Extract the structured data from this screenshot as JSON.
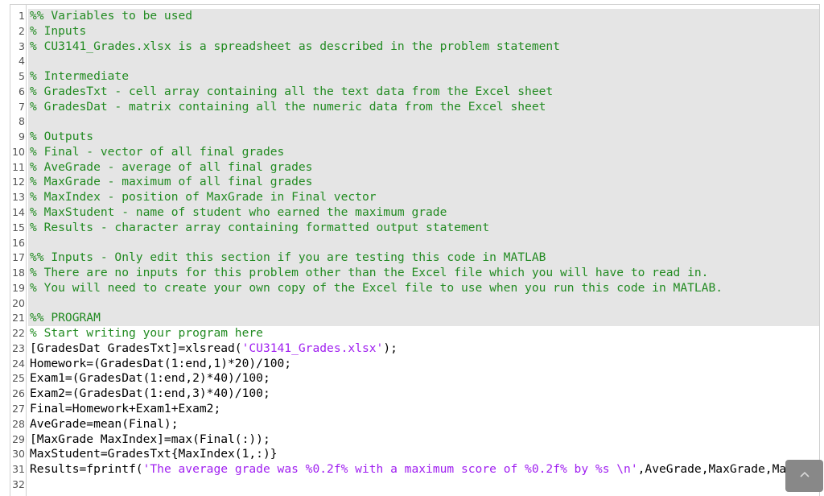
{
  "editor": {
    "colors": {
      "comment": "#228b22",
      "string": "#a020f0",
      "code": "#000000",
      "shaded_section": "#e5e5e5"
    },
    "shaded_lines_through": 21,
    "lines": [
      {
        "n": "1",
        "segs": [
          {
            "type": "comment",
            "text": "%% Variables to be used"
          }
        ]
      },
      {
        "n": "2",
        "segs": [
          {
            "type": "comment",
            "text": "% Inputs"
          }
        ]
      },
      {
        "n": "3",
        "segs": [
          {
            "type": "comment",
            "text": "% CU3141_Grades.xlsx is a spreadsheet as described in the problem statement"
          }
        ]
      },
      {
        "n": "4",
        "segs": []
      },
      {
        "n": "5",
        "segs": [
          {
            "type": "comment",
            "text": "% Intermediate"
          }
        ]
      },
      {
        "n": "6",
        "segs": [
          {
            "type": "comment",
            "text": "% GradesTxt - cell array containing all the text data from the Excel sheet"
          }
        ]
      },
      {
        "n": "7",
        "segs": [
          {
            "type": "comment",
            "text": "% GradesDat - matrix containing all the numeric data from the Excel sheet"
          }
        ]
      },
      {
        "n": "8",
        "segs": []
      },
      {
        "n": "9",
        "segs": [
          {
            "type": "comment",
            "text": "% Outputs"
          }
        ]
      },
      {
        "n": "10",
        "segs": [
          {
            "type": "comment",
            "text": "% Final - vector of all final grades"
          }
        ]
      },
      {
        "n": "11",
        "segs": [
          {
            "type": "comment",
            "text": "% AveGrade - average of all final grades"
          }
        ]
      },
      {
        "n": "12",
        "segs": [
          {
            "type": "comment",
            "text": "% MaxGrade - maximum of all final grades"
          }
        ]
      },
      {
        "n": "13",
        "segs": [
          {
            "type": "comment",
            "text": "% MaxIndex - position of MaxGrade in Final vector"
          }
        ]
      },
      {
        "n": "14",
        "segs": [
          {
            "type": "comment",
            "text": "% MaxStudent - name of student who earned the maximum grade"
          }
        ]
      },
      {
        "n": "15",
        "segs": [
          {
            "type": "comment",
            "text": "% Results - character array containing formatted output statement"
          }
        ]
      },
      {
        "n": "16",
        "segs": []
      },
      {
        "n": "17",
        "segs": [
          {
            "type": "comment",
            "text": "%% Inputs - Only edit this section if you are testing this code in MATLAB"
          }
        ]
      },
      {
        "n": "18",
        "segs": [
          {
            "type": "comment",
            "text": "% There are no inputs for this problem other than the Excel file which you will have to read in."
          }
        ]
      },
      {
        "n": "19",
        "segs": [
          {
            "type": "comment",
            "text": "% You will need to create your own copy of the Excel file to use when you run this code in MATLAB."
          }
        ]
      },
      {
        "n": "20",
        "segs": []
      },
      {
        "n": "21",
        "segs": [
          {
            "type": "comment",
            "text": "%% PROGRAM"
          }
        ]
      },
      {
        "n": "22",
        "segs": [
          {
            "type": "comment",
            "text": "% Start writing your program here"
          }
        ]
      },
      {
        "n": "23",
        "segs": [
          {
            "type": "plain",
            "text": "[GradesDat GradesTxt]=xlsread("
          },
          {
            "type": "string",
            "text": "'CU3141_Grades.xlsx'"
          },
          {
            "type": "plain",
            "text": ");"
          }
        ]
      },
      {
        "n": "24",
        "segs": [
          {
            "type": "plain",
            "text": "Homework=(GradesDat(1:end,1)*20)/100;"
          }
        ]
      },
      {
        "n": "25",
        "segs": [
          {
            "type": "plain",
            "text": "Exam1=(GradesDat(1:end,2)*40)/100;"
          }
        ]
      },
      {
        "n": "26",
        "segs": [
          {
            "type": "plain",
            "text": "Exam2=(GradesDat(1:end,3)*40)/100;"
          }
        ]
      },
      {
        "n": "27",
        "segs": [
          {
            "type": "plain",
            "text": "Final=Homework+Exam1+Exam2;"
          }
        ]
      },
      {
        "n": "28",
        "segs": [
          {
            "type": "plain",
            "text": "AveGrade=mean(Final);"
          }
        ]
      },
      {
        "n": "29",
        "segs": [
          {
            "type": "plain",
            "text": "[MaxGrade MaxIndex]=max(Final(:));"
          }
        ]
      },
      {
        "n": "30",
        "segs": [
          {
            "type": "plain",
            "text": "MaxStudent=GradesTxt{MaxIndex(1,:)}"
          }
        ]
      },
      {
        "n": "31",
        "segs": [
          {
            "type": "plain",
            "text": "Results=fprintf("
          },
          {
            "type": "string",
            "text": "'The average grade was %0.2f% with a maximum score of %0.2f% by %s \\n'"
          },
          {
            "type": "plain",
            "text": ",AveGrade,MaxGrade,Ma"
          }
        ]
      },
      {
        "n": "32",
        "segs": []
      }
    ]
  },
  "scroll_to_top": {
    "icon": "chevron-up-icon"
  }
}
